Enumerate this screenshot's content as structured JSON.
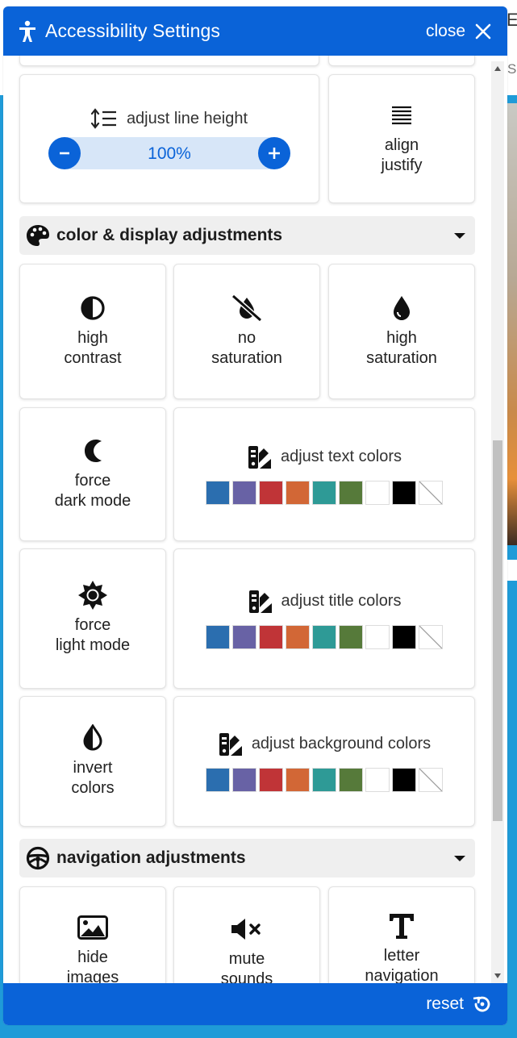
{
  "background": {
    "fragment_top": "Ev",
    "fragment_mid": "S"
  },
  "header": {
    "title": "Accessibility Settings",
    "close_label": "close"
  },
  "line_height": {
    "label": "adjust line height",
    "value": "100%"
  },
  "align": {
    "label": "align\njustify"
  },
  "sections": {
    "color": {
      "title": "color & display adjustments",
      "icon": "palette-icon"
    },
    "navigation": {
      "title": "navigation adjustments",
      "icon": "steering-wheel-icon"
    }
  },
  "color_cards": {
    "high_contrast": "high\ncontrast",
    "no_saturation": "no\nsaturation",
    "high_saturation": "high\nsaturation",
    "dark_mode": "force\ndark mode",
    "light_mode": "force\nlight mode",
    "invert": "invert\ncolors"
  },
  "color_pickers": {
    "text": "adjust text colors",
    "title": "adjust title colors",
    "background": "adjust background colors"
  },
  "swatch_colors": [
    "#2b6eaf",
    "#6862a5",
    "#c03437",
    "#d26736",
    "#2e9a96",
    "#567a3a",
    "#ffffff",
    "#000000"
  ],
  "nav_cards": {
    "hide_images": "hide\nimages",
    "mute_sounds": "mute\nsounds",
    "letter_navigation": "letter\nnavigation"
  },
  "footer": {
    "reset_label": "reset"
  },
  "colors": {
    "brand": "#0a63d8",
    "page_bg": "#1f9bd8",
    "stepper_bg": "#d7e6f8",
    "section_bg": "#efefef"
  }
}
